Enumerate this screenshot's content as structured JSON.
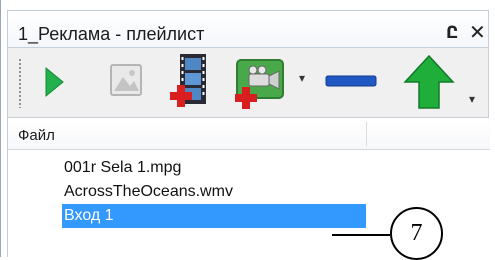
{
  "window": {
    "title": "1_Реклама - плейлист",
    "pin_label": "Ը",
    "close_label": "✕"
  },
  "toolbar": {
    "buttons": [
      {
        "name": "play",
        "icon": "play-icon",
        "color": "#22b14c"
      },
      {
        "name": "image",
        "icon": "image-icon",
        "color": "#b8b8b8"
      },
      {
        "name": "add-file",
        "icon": "film-add-icon",
        "color": "#d81e1e"
      },
      {
        "name": "add-camera",
        "icon": "camera-add-icon",
        "color": "#4caf50"
      },
      {
        "name": "remove",
        "icon": "minus-icon",
        "color": "#1f57c3"
      },
      {
        "name": "move-up",
        "icon": "arrow-up-icon",
        "color": "#1fae3a"
      }
    ],
    "dropdown_glyph": "▾",
    "overflow_glyph": "▾"
  },
  "list": {
    "header": "Файл",
    "items": [
      {
        "label": "001r Sela 1.mpg",
        "selected": false
      },
      {
        "label": "AcrossTheOceans.wmv",
        "selected": false
      },
      {
        "label": "Вход 1",
        "selected": true
      }
    ]
  },
  "callout": {
    "number": "7"
  },
  "colors": {
    "selection": "#3399ff",
    "toolbar_bg": "#f0f0f0",
    "border": "#c9ced6"
  }
}
